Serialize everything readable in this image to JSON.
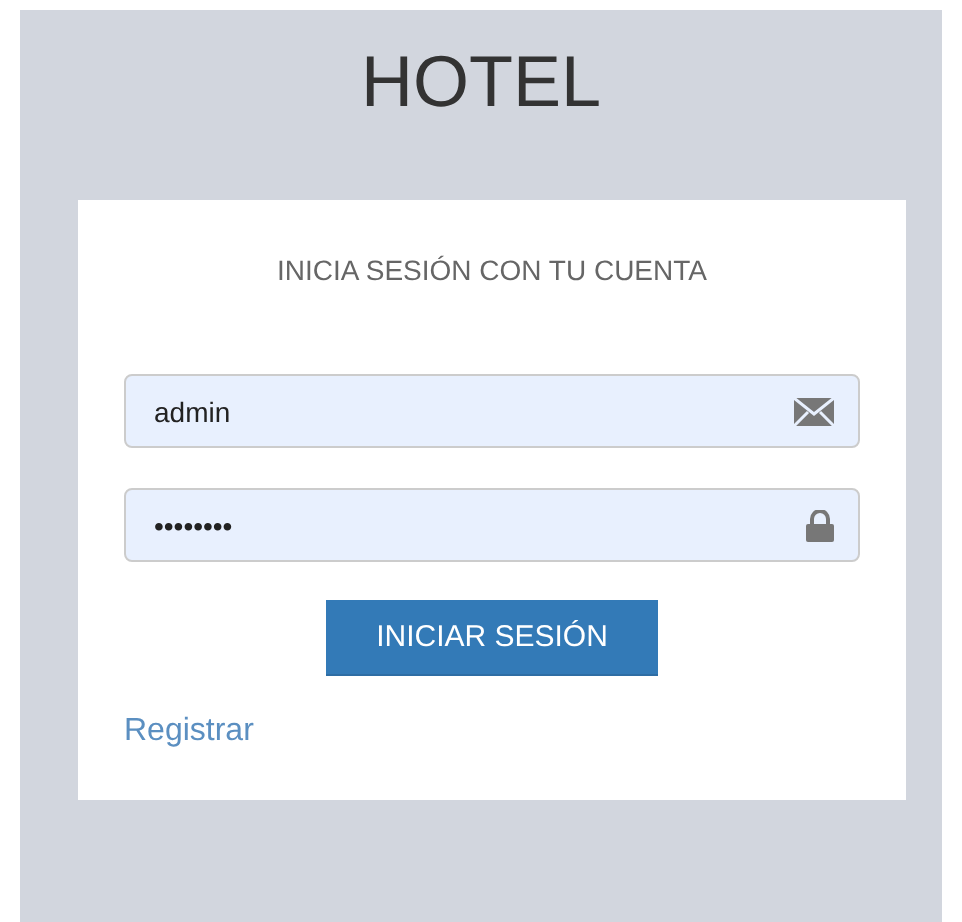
{
  "title": "HOTEL",
  "form": {
    "heading": "INICIA SESIÓN CON TU CUENTA",
    "fields": [
      {
        "kind": "user",
        "value": "admin"
      },
      {
        "kind": "password",
        "value": "••••••••"
      }
    ],
    "submit": "INICIAR SESIÓN",
    "link": "Registrar"
  }
}
